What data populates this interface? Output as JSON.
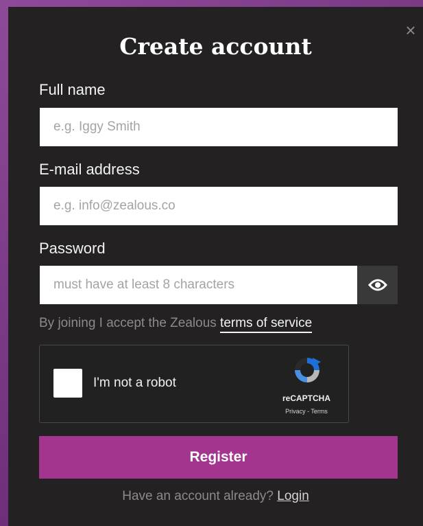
{
  "dialog": {
    "title": "Create account",
    "close_label": "×"
  },
  "fields": {
    "full_name": {
      "label": "Full name",
      "placeholder": "e.g. Iggy Smith",
      "value": ""
    },
    "email": {
      "label": "E-mail address",
      "placeholder": "e.g. info@zealous.co",
      "value": ""
    },
    "password": {
      "label": "Password",
      "placeholder": "must have at least 8 characters",
      "value": "",
      "toggle_icon": "eye-icon"
    }
  },
  "terms": {
    "prefix": "By joining I accept the Zealous",
    "link_text": "terms of service"
  },
  "captcha": {
    "label": "I'm not a robot",
    "brand": "reCAPTCHA",
    "links": "Privacy - Terms",
    "checked": false
  },
  "register_button": {
    "label": "Register"
  },
  "login_prompt": {
    "text": "Have an account already?",
    "link_text": "Login"
  },
  "colors": {
    "modal_bg": "#232122",
    "accent": "#a3358f",
    "background": "#7a3a86"
  }
}
